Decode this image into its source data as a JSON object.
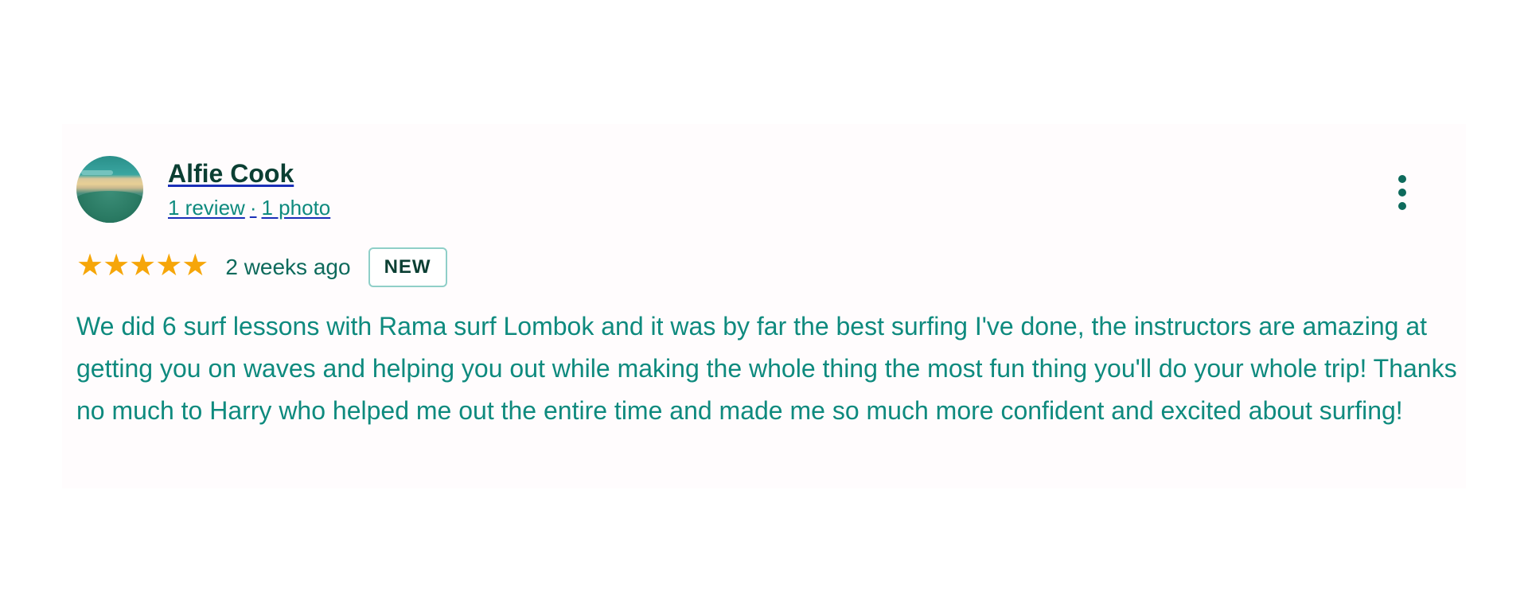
{
  "review": {
    "author": {
      "name": "Alfie Cook",
      "reviews_link": "1 review",
      "separator": "·",
      "photos_link": "1 photo"
    },
    "rating": {
      "stars_text": "★★★★★",
      "value": 5,
      "max": 5
    },
    "date": "2 weeks ago",
    "badge": "NEW",
    "text": "We did 6 surf lessons with Rama surf Lombok and it was by far the best surfing I've done, the instructors are amazing at getting you on waves and helping you out while making the whole thing the most fun thing you'll do your whole trip! Thanks no much to Harry who helped me out the entire time and made me so much more confident and excited about surfing!",
    "more_icon": "more-vert-icon",
    "avatar_icon": "profile-photo"
  },
  "colors": {
    "star": "#f6a609",
    "text": "#0e8a7e",
    "name": "#0b3f33",
    "link_underline": "#1a2fb8"
  }
}
